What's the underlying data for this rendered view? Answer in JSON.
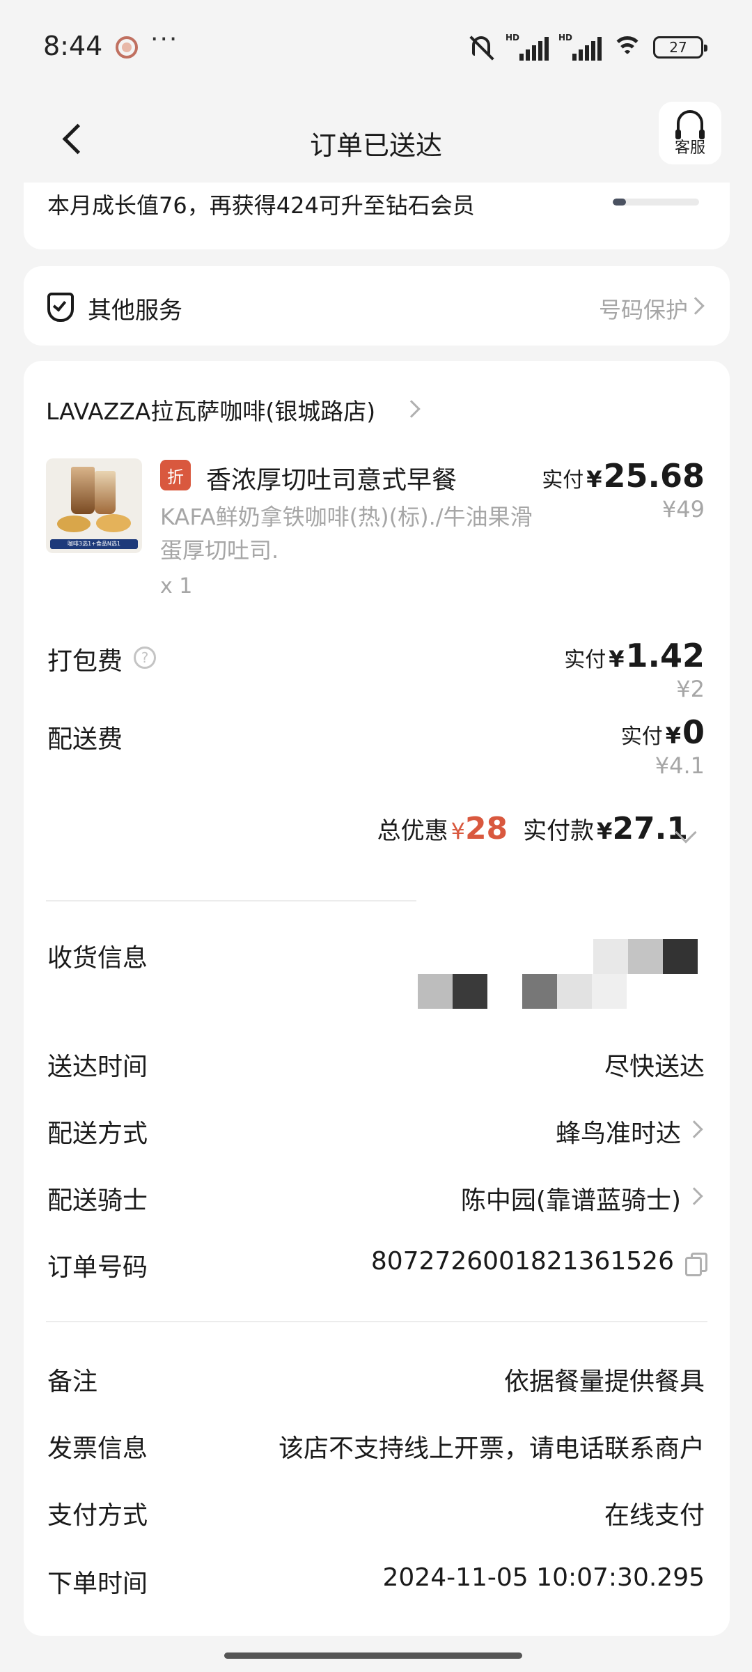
{
  "status_bar": {
    "time": "8:44",
    "more": "···",
    "hd": "HD",
    "battery": "27"
  },
  "header": {
    "title": "订单已送达",
    "service_label": "客服"
  },
  "growth": {
    "text": "本月成长值76，再获得424可升至钻石会员",
    "progress_fraction": 0.15
  },
  "services": {
    "title": "其他服务",
    "right_label": "号码保护"
  },
  "order": {
    "store_name": "LAVAZZA拉瓦萨咖啡(银城路店)",
    "product": {
      "tag": "折",
      "name": "香浓厚切吐司意式早餐",
      "desc": "KAFA鲜奶拿铁咖啡(热)(标)./牛油果滑蛋厚切吐司.",
      "qty": "x 1",
      "image_caption": "咖啡3选1+食品N选1",
      "paid_label": "实付",
      "yen": "¥",
      "paid": "25.68",
      "original": "¥49"
    },
    "packing": {
      "label": "打包费",
      "help": "?",
      "paid_label": "实付",
      "yen": "¥",
      "paid": "1.42",
      "original": "¥2"
    },
    "delivery_fee": {
      "label": "配送费",
      "paid_label": "实付",
      "yen": "¥",
      "paid": "0",
      "original": "¥4.1"
    },
    "totals": {
      "discount_label": "总优惠",
      "yen": "¥",
      "discount": "28",
      "paid_label": "实付款",
      "paid": "27.1"
    }
  },
  "info": {
    "receiver_label": "收货信息",
    "delivery_time_label": "送达时间",
    "delivery_time": "尽快送达",
    "delivery_method_label": "配送方式",
    "delivery_method": "蜂鸟准时达",
    "rider_label": "配送骑士",
    "rider": "陈中园(靠谱蓝骑士)",
    "order_no_label": "订单号码",
    "order_no": "8072726001821361526",
    "remark_label": "备注",
    "remark": "依据餐量提供餐具",
    "invoice_label": "发票信息",
    "invoice": "该店不支持线上开票，请电话联系商户",
    "payment_label": "支付方式",
    "payment": "在线支付",
    "order_time_label": "下单时间",
    "order_time": "2024-11-05 10:07:30.295"
  },
  "colors": {
    "accent_red": "#d9583e",
    "muted_gray": "#a6a6a6",
    "background": "#f4f4f4"
  },
  "icons": [
    "back-icon",
    "headset-icon",
    "shield-icon",
    "chevron-right-icon",
    "help-icon",
    "chevron-down-icon",
    "copy-icon",
    "mute-icon",
    "signal-icon",
    "wifi-icon",
    "battery-icon"
  ]
}
